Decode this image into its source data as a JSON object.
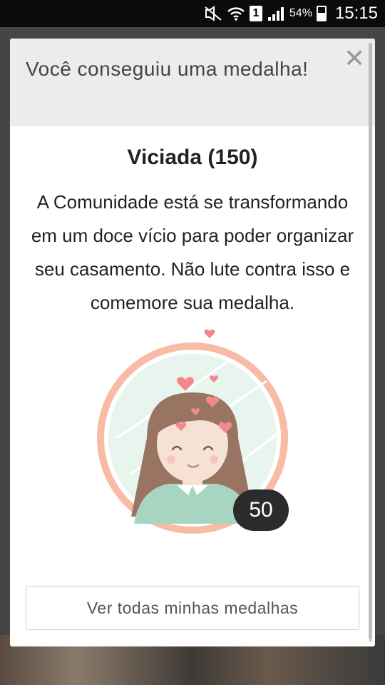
{
  "status_bar": {
    "battery_percent": "54%",
    "time": "15:15",
    "sim_label": "1",
    "icons": [
      "mute-icon",
      "wifi-icon",
      "sim-icon",
      "signal-icon",
      "battery-icon"
    ]
  },
  "modal": {
    "title": "Você conseguiu uma medalha!",
    "close_symbol": "✕",
    "medal_name": "Viciada (150)",
    "description": "A Comunidade está se transformando em um doce vício para poder organizar seu casamento. Não lute contra isso e comemore sua medalha.",
    "medal_count": "50",
    "button_label": "Ver todas minhas medalhas"
  },
  "colors": {
    "header_bg": "#ececec",
    "ring": "#f7bba6",
    "circle_fill": "#e8f5ee",
    "hair": "#9a7462",
    "shirt": "#a8d5c2",
    "heart": "#f08a8a",
    "badge_bg": "#2b2b2b"
  }
}
